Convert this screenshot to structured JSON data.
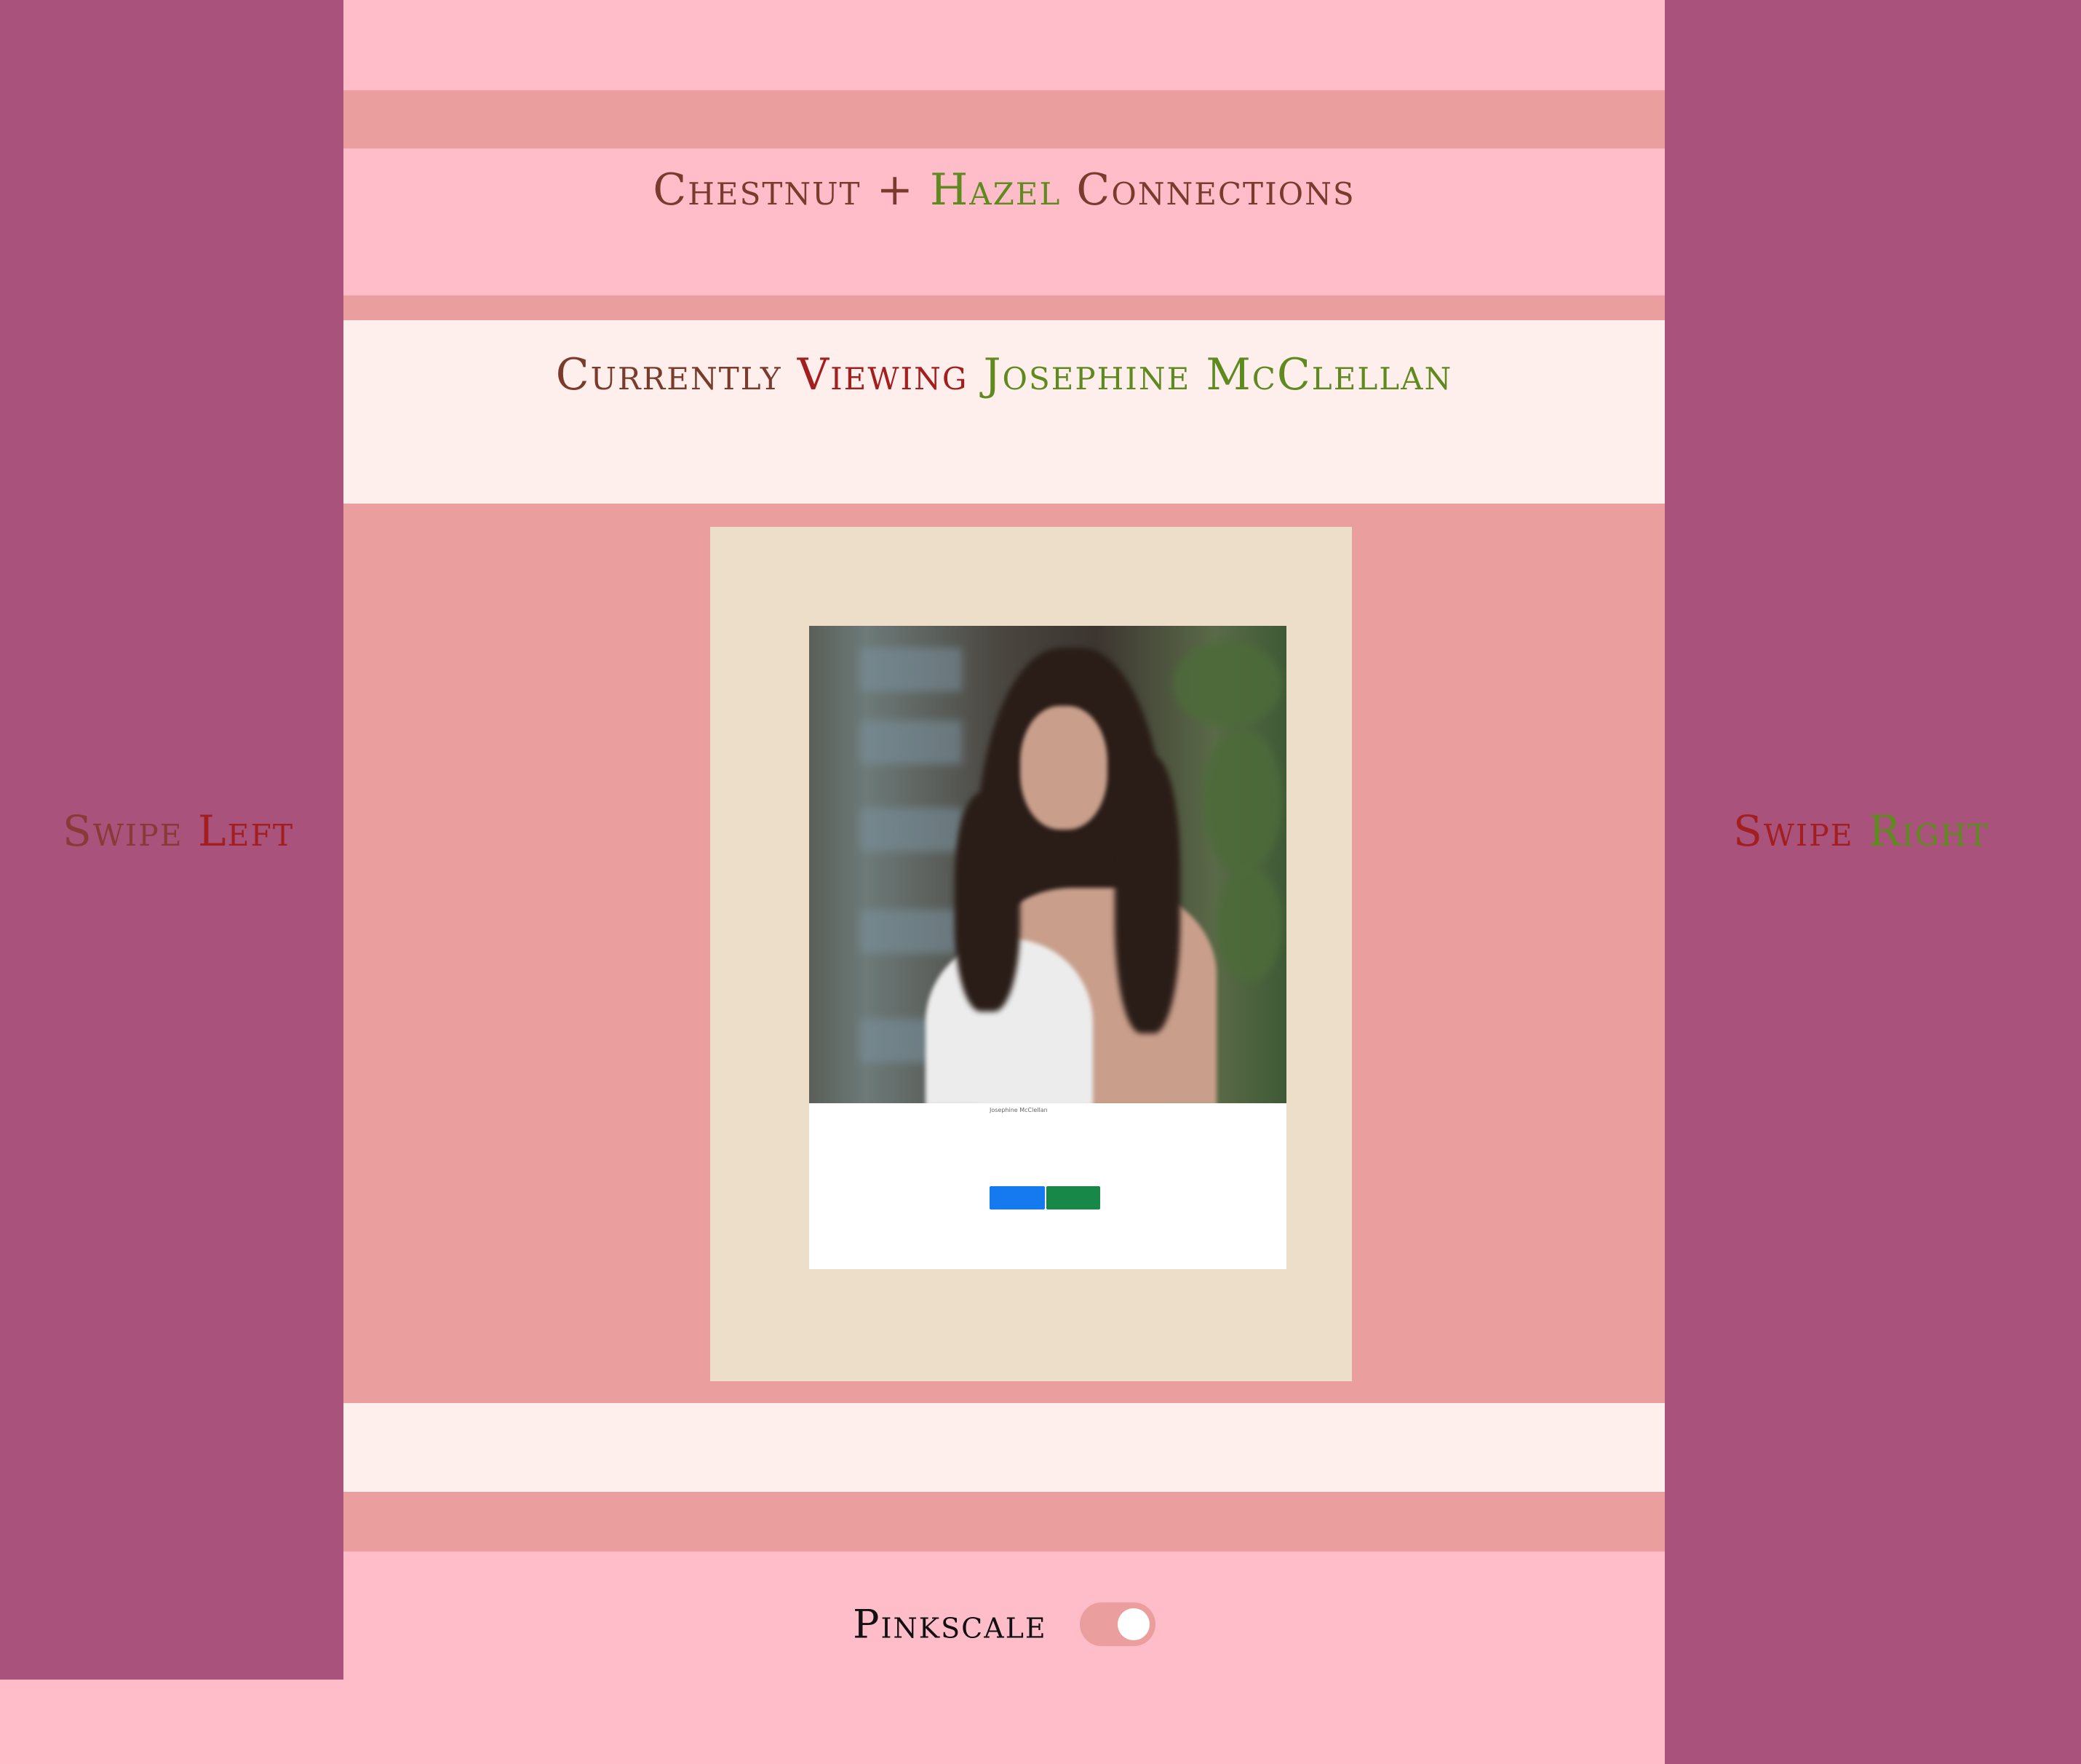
{
  "colors": {
    "side_panel": "#a9527b",
    "pink_light": "#ffbdc9",
    "pink_stripe": "#ea9e9e",
    "cream": "#ffefec",
    "card_frame": "#ecdec8",
    "brown": "#7a3b2c",
    "red": "#a31f1f",
    "green": "#5f8a1f",
    "blue_button": "#1579f0",
    "green_button": "#188848"
  },
  "header": {
    "title_part1": "Chestnut +",
    "title_part2": "Hazel",
    "title_part3": "Connections"
  },
  "viewing": {
    "prefix": "Currently",
    "verb": "Viewing",
    "name": "Josephine McClellan"
  },
  "swipe_left": {
    "word": "Swipe",
    "direction": "Left"
  },
  "swipe_right": {
    "word": "Swipe",
    "direction": "Right"
  },
  "profile_card": {
    "photo_icon": "profile-photo",
    "name": "Josephine McClellan",
    "lines": [
      "",
      "",
      "",
      ""
    ],
    "reject_label": "",
    "accept_label": ""
  },
  "footer": {
    "toggle_label": "Pinkscale",
    "toggle_on": true
  }
}
